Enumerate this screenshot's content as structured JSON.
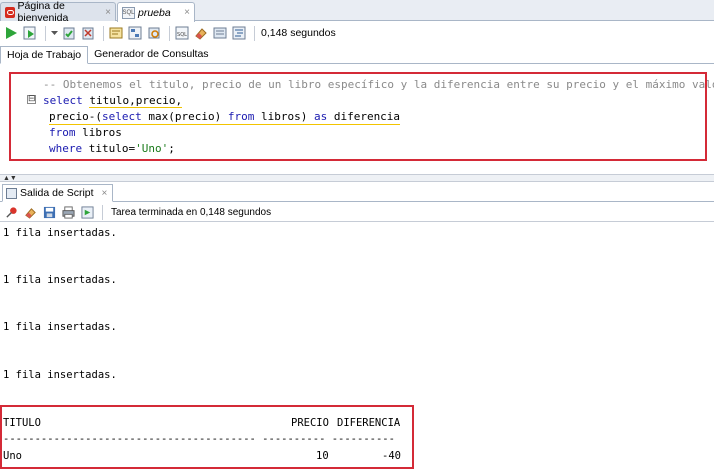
{
  "doc_tabs": [
    {
      "label": "Página de bienvenida",
      "close": "×"
    },
    {
      "label": "prueba",
      "close": "×"
    }
  ],
  "toolbar": {
    "timing": "0,148 segundos",
    "icons": [
      "run-statement",
      "run-script",
      "dropdown",
      "commit",
      "rollback",
      "autotrace",
      "explain-plan",
      "sql-tuning",
      "eraser",
      "history",
      "format"
    ]
  },
  "sub_tabs": [
    "Hoja de Trabajo",
    "Generador de Consultas"
  ],
  "editor": {
    "fold_marker": "⊟",
    "comment": "-- Obtenemos el titulo, precio de un libro específico y la diferencia entre su precio y el máximo valor:",
    "line2": {
      "kw": "select",
      "rest": "titulo,precio,"
    },
    "line3": {
      "a": "precio-(",
      "kw1": "select",
      "b": "max",
      "c": "(precio) ",
      "kw2": "from",
      "d": "libros) ",
      "kw3": "as",
      "e": "diferencia"
    },
    "line4": {
      "kw": "from",
      "rest": "libros"
    },
    "line5": {
      "kw": "where",
      "rest": "titulo=",
      "str": "'Uno'",
      "end": ";"
    }
  },
  "output_panel": {
    "tab_label": "Salida de Script",
    "tab_close": "×",
    "status": "Tarea terminada en 0,148 segundos",
    "messages": [
      "1 fila insertadas.",
      "1 fila insertadas.",
      "1 fila insertadas.",
      "1 fila insertadas."
    ],
    "result_table": {
      "headers": [
        "TITULO",
        "PRECIO",
        "DIFERENCIA"
      ],
      "separator": "---------------------------------------- ---------- ----------",
      "rows": [
        [
          "Uno",
          "10",
          "-40"
        ]
      ]
    }
  },
  "colors": {
    "highlight_box": "#d42a37",
    "keyword": "#1a1ab0",
    "comment": "#8a8a8a",
    "string": "#1a7a1a",
    "warning_underline": "#f2c400"
  }
}
